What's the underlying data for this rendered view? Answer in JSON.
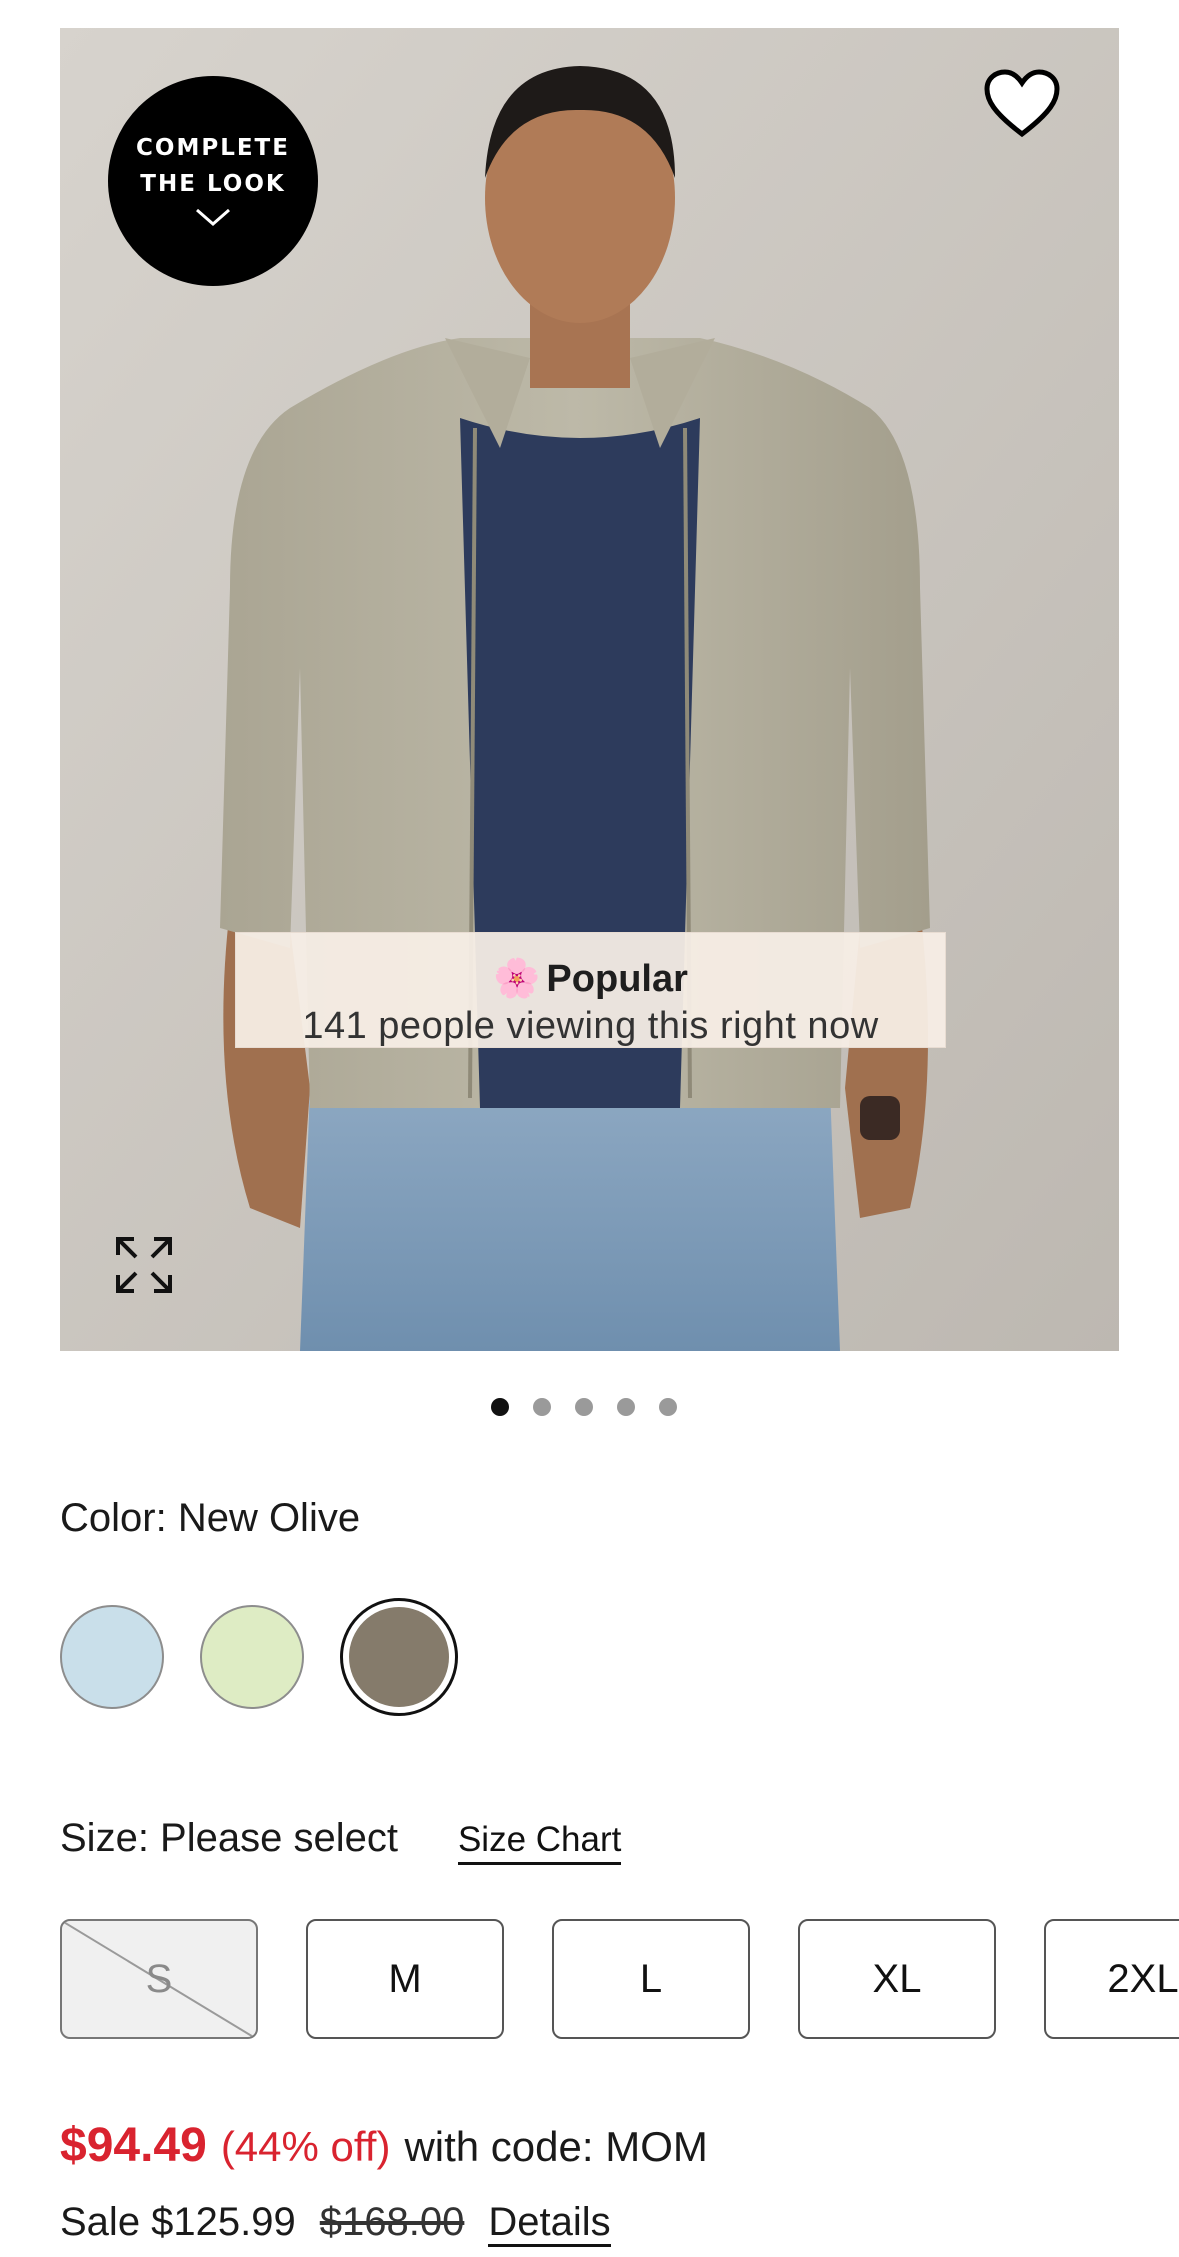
{
  "badge": {
    "line1": "COMPLETE",
    "line2": "THE LOOK"
  },
  "popular": {
    "emoji": "🌸",
    "title": "Popular",
    "subtitle": "141 people viewing this right now"
  },
  "carousel": {
    "count": 5,
    "active_index": 0
  },
  "color": {
    "label": "Color: New Olive",
    "swatches": [
      {
        "name": "light blue",
        "hex": "#c9dfea"
      },
      {
        "name": "light green",
        "hex": "#deecc4"
      },
      {
        "name": "New Olive",
        "hex": "#857b6b",
        "selected": true
      }
    ]
  },
  "size": {
    "label": "Size: Please select",
    "chart_link": "Size Chart",
    "options": [
      {
        "label": "S",
        "available": false
      },
      {
        "label": "M",
        "available": true
      },
      {
        "label": "L",
        "available": true
      },
      {
        "label": "XL",
        "available": true
      },
      {
        "label": "2XL",
        "available": true
      }
    ]
  },
  "price": {
    "promo_price": "$94.49",
    "percent_off": "(44% off)",
    "code_text": "with code: MOM",
    "sale_text": "Sale $125.99",
    "original": "$168.00",
    "details_link": "Details"
  },
  "icons": {
    "favorite": "heart-icon",
    "expand": "expand-icon",
    "badge_chevron": "chevron-down-icon"
  }
}
